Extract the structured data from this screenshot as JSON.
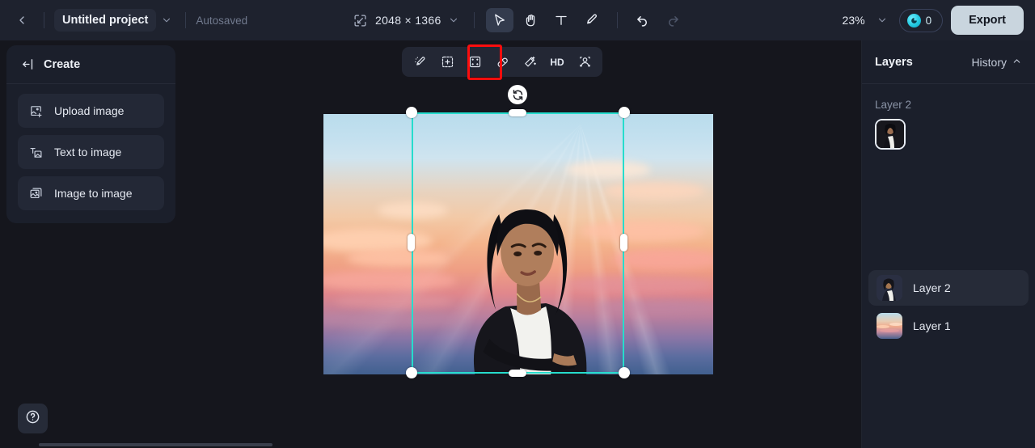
{
  "app": {
    "title": "AI Image Editor",
    "bg_color": "#15161d",
    "accent_color": "#26dccd",
    "topbar_color": "#1e222e",
    "panel_color": "#1b1f2b",
    "highlight_color": "#fb0d0d"
  },
  "topbar": {
    "back_icon": "chevron-left-icon",
    "project_name": "Untitled project",
    "project_dropdown_icon": "chevron-down-icon",
    "autosave_status": "Autosaved",
    "resize_icon": "resize-canvas-icon",
    "dimensions": "2048 × 1366",
    "dimensions_dropdown_icon": "chevron-down-icon",
    "tools": [
      {
        "name": "select-tool",
        "icon": "cursor-arrow-icon",
        "active": true
      },
      {
        "name": "hand-tool",
        "icon": "hand-icon",
        "active": false
      },
      {
        "name": "text-tool",
        "icon": "text-t-icon",
        "active": false
      },
      {
        "name": "brush-tool",
        "icon": "brush-icon",
        "active": false
      }
    ],
    "undo_icon": "undo-arrow-icon",
    "redo_icon": "redo-arrow-icon",
    "redo_disabled": true,
    "zoom_level": "23%",
    "zoom_dropdown_icon": "chevron-down-icon",
    "credits_icon": "credit-coin-icon",
    "credits_count": "0",
    "export_label": "Export"
  },
  "left_panel": {
    "collapse_icon": "collapse-panel-icon",
    "title": "Create",
    "items": [
      {
        "label": "Upload image",
        "icon": "upload-image-icon"
      },
      {
        "label": "Text to image",
        "icon": "text-to-image-icon"
      },
      {
        "label": "Image to image",
        "icon": "image-to-image-icon"
      }
    ]
  },
  "canvas_toolbar": {
    "highlighted_index": 2,
    "buttons": [
      {
        "label": "",
        "icon": "magic-retouch-icon",
        "name": "retouch-tool"
      },
      {
        "label": "",
        "icon": "generative-fill-icon",
        "name": "generative-fill-tool"
      },
      {
        "label": "",
        "icon": "crop-expand-icon",
        "name": "crop-expand-tool"
      },
      {
        "label": "",
        "icon": "eraser-icon",
        "name": "eraser-tool"
      },
      {
        "label": "",
        "icon": "magic-wand-icon",
        "name": "magic-wand-tool"
      },
      {
        "label": "HD",
        "icon": "hd-upscale-icon",
        "name": "hd-upscale-tool"
      },
      {
        "label": "",
        "icon": "portrait-enhance-icon",
        "name": "portrait-enhance-tool"
      }
    ]
  },
  "canvas": {
    "artboard_name": "artboard",
    "image_description": "Portrait of a woman in a white top and black jacket against a sunset sky with clouds and sun rays",
    "selection": {
      "active": true,
      "rotate_icon": "rotate-handle-icon",
      "handles": [
        "top-left",
        "top-center",
        "top-right",
        "middle-left",
        "middle-right",
        "bottom-left",
        "bottom-center",
        "bottom-right"
      ]
    }
  },
  "right_panel": {
    "title": "Layers",
    "history_label": "History",
    "history_icon": "chevron-up-icon",
    "active_layer_name": "Layer 2",
    "active_thumbnail": "layer-2-thumbnail",
    "layers": [
      {
        "label": "Layer 2",
        "selected": true,
        "thumbnail": "portrait-thumbnail"
      },
      {
        "label": "Layer 1",
        "selected": false,
        "thumbnail": "sky-thumbnail"
      }
    ]
  },
  "footer": {
    "help_icon": "help-question-icon",
    "scrollbar": "horizontal-scrollbar"
  }
}
